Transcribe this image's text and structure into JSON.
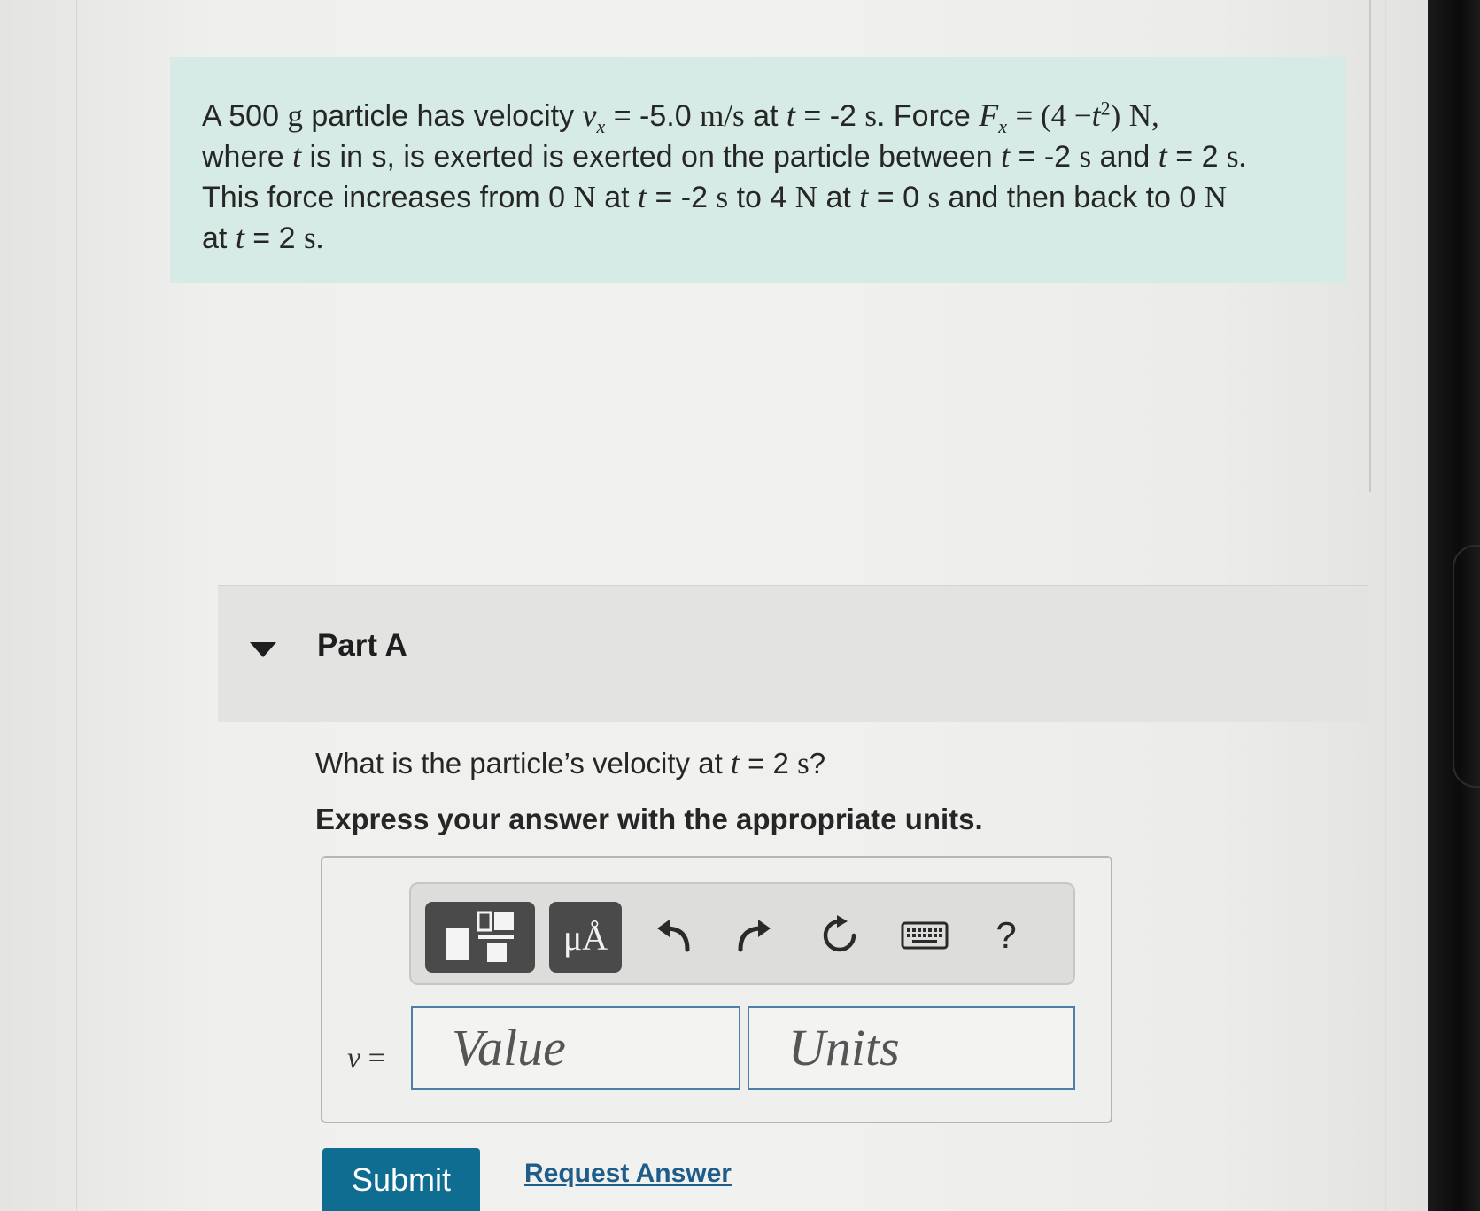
{
  "problem": {
    "text_1": "A 500",
    "unit_g": "g",
    "text_2": "particle has velocity",
    "var_v": "v",
    "sub_x": "x",
    "text_3": "= -5.0",
    "unit_ms": "m/s",
    "text_4": "at",
    "var_t1": "t",
    "text_5": "= -2",
    "unit_s1": "s",
    "text_6": ". Force",
    "var_F": "F",
    "sub_x2": "x",
    "eq_force_a": "= (4 −",
    "var_t2": "t",
    "sup_2": "2",
    "eq_force_b": ")",
    "unit_N1": "N",
    "comma": ",",
    "text_7": "where",
    "var_t3": "t",
    "text_8": "is in s, is exerted is exerted on the particle between",
    "var_t4": "t",
    "text_9": "= -2",
    "unit_s2": "s",
    "text_10": "and",
    "var_t5": "t",
    "text_11": "= 2",
    "unit_s3": "s.",
    "text_12": "This force increases from 0",
    "unit_N2": "N",
    "text_13": "at",
    "var_t6": "t",
    "text_14": "= -2",
    "unit_s4": "s",
    "text_15": "to 4",
    "unit_N3": "N",
    "text_16": "at",
    "var_t7": "t",
    "text_17": "= 0",
    "unit_s5": "s",
    "text_18": "and then back to 0",
    "unit_N4": "N",
    "text_19": "at",
    "var_t8": "t",
    "text_20": "= 2",
    "unit_s6": "s."
  },
  "part": {
    "title": "Part A",
    "question_a": "What is the particle’s velocity at",
    "question_var": "t",
    "question_b": "= 2",
    "question_unit": "s",
    "question_c": "?",
    "instruction": "Express your answer with the appropriate units."
  },
  "toolbar": {
    "units_label": "μÅ",
    "help_label": "?"
  },
  "answer": {
    "var": "v",
    "equals": "=",
    "value_placeholder": "Value",
    "units_placeholder": "Units"
  },
  "actions": {
    "submit_label": "Submit",
    "request_label": "Request Answer"
  }
}
